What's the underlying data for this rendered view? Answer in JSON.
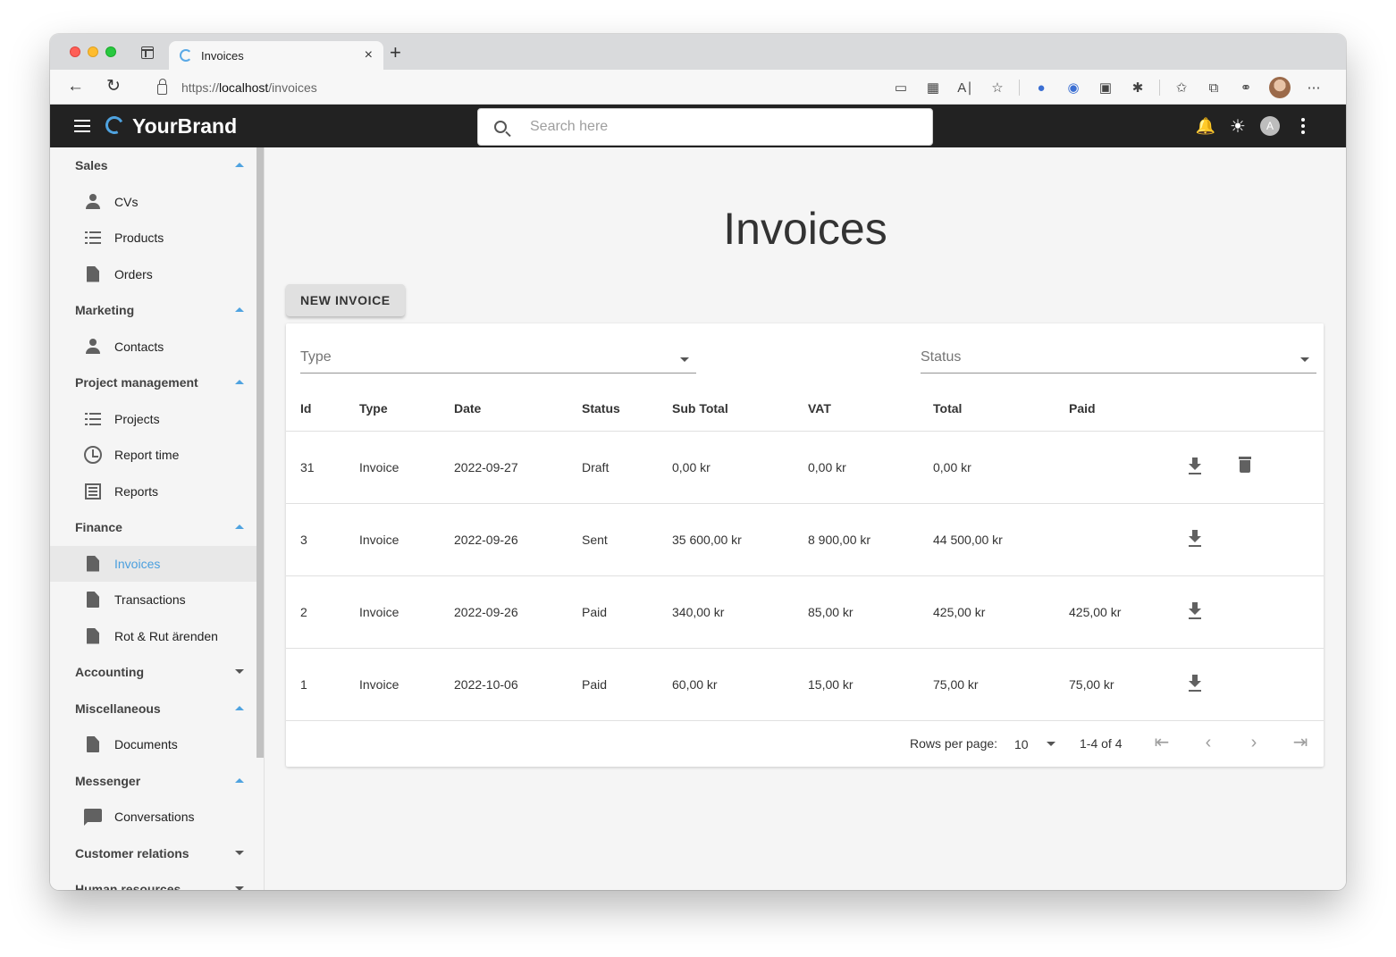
{
  "browser": {
    "tab_title": "Invoices",
    "tab_close": "×",
    "new_tab": "+",
    "url_prefix": "https://",
    "url_host": "localhost",
    "url_path": "/invoices",
    "icons": [
      "sidebar-layout-icon",
      "back-icon",
      "reload-icon",
      "lock-icon",
      "app-available-icon",
      "apps-icon",
      "read-aloud-icon",
      "add-favorite-icon",
      "extension-1-icon",
      "extension-2-icon",
      "extension-3-icon",
      "extensions-icon",
      "favorites-icon",
      "collections-icon",
      "share-icon",
      "profile-icon",
      "more-icon"
    ]
  },
  "appbar": {
    "brand": "YourBrand",
    "search_placeholder": "Search here",
    "avatar_letter": "A",
    "brand_color": "#4fa3e0"
  },
  "sidebar": {
    "groups": [
      {
        "label": "Sales",
        "expanded": true,
        "items": [
          {
            "label": "CVs",
            "icon": "person-icon"
          },
          {
            "label": "Products",
            "icon": "list-icon"
          },
          {
            "label": "Orders",
            "icon": "document-icon"
          }
        ]
      },
      {
        "label": "Marketing",
        "expanded": true,
        "items": [
          {
            "label": "Contacts",
            "icon": "person-icon"
          }
        ]
      },
      {
        "label": "Project management",
        "expanded": true,
        "items": [
          {
            "label": "Projects",
            "icon": "list-icon"
          },
          {
            "label": "Report time",
            "icon": "clock-icon"
          },
          {
            "label": "Reports",
            "icon": "report-icon"
          }
        ]
      },
      {
        "label": "Finance",
        "expanded": true,
        "items": [
          {
            "label": "Invoices",
            "icon": "document-icon",
            "active": true
          },
          {
            "label": "Transactions",
            "icon": "document-icon"
          },
          {
            "label": "Rot & Rut ärenden",
            "icon": "document-icon"
          }
        ]
      },
      {
        "label": "Accounting",
        "expanded": false,
        "items": []
      },
      {
        "label": "Miscellaneous",
        "expanded": true,
        "items": [
          {
            "label": "Documents",
            "icon": "document-icon"
          }
        ]
      },
      {
        "label": "Messenger",
        "expanded": true,
        "items": [
          {
            "label": "Conversations",
            "icon": "chat-icon"
          }
        ]
      },
      {
        "label": "Customer relations",
        "expanded": false,
        "items": []
      },
      {
        "label": "Human resources",
        "expanded": false,
        "items": []
      }
    ],
    "active_color": "#4a9fde"
  },
  "main": {
    "title": "Invoices",
    "new_button": "NEW INVOICE",
    "filters": {
      "type_label": "Type",
      "status_label": "Status"
    },
    "table": {
      "headers": [
        "Id",
        "Type",
        "Date",
        "Status",
        "Sub Total",
        "VAT",
        "Total",
        "Paid"
      ],
      "rows": [
        {
          "id": "31",
          "type": "Invoice",
          "date": "2022-09-27",
          "status": "Draft",
          "sub_total": "0,00 kr",
          "vat": "0,00 kr",
          "total": "0,00 kr",
          "paid": "",
          "can_delete": true
        },
        {
          "id": "3",
          "type": "Invoice",
          "date": "2022-09-26",
          "status": "Sent",
          "sub_total": "35 600,00 kr",
          "vat": "8 900,00 kr",
          "total": "44 500,00 kr",
          "paid": "",
          "can_delete": false
        },
        {
          "id": "2",
          "type": "Invoice",
          "date": "2022-09-26",
          "status": "Paid",
          "sub_total": "340,00 kr",
          "vat": "85,00 kr",
          "total": "425,00 kr",
          "paid": "425,00 kr",
          "can_delete": false
        },
        {
          "id": "1",
          "type": "Invoice",
          "date": "2022-10-06",
          "status": "Paid",
          "sub_total": "60,00 kr",
          "vat": "15,00 kr",
          "total": "75,00 kr",
          "paid": "75,00 kr",
          "can_delete": false
        }
      ]
    },
    "pagination": {
      "rows_per_page_label": "Rows per page:",
      "rows_per_page": "10",
      "range": "1-4 of 4"
    }
  }
}
